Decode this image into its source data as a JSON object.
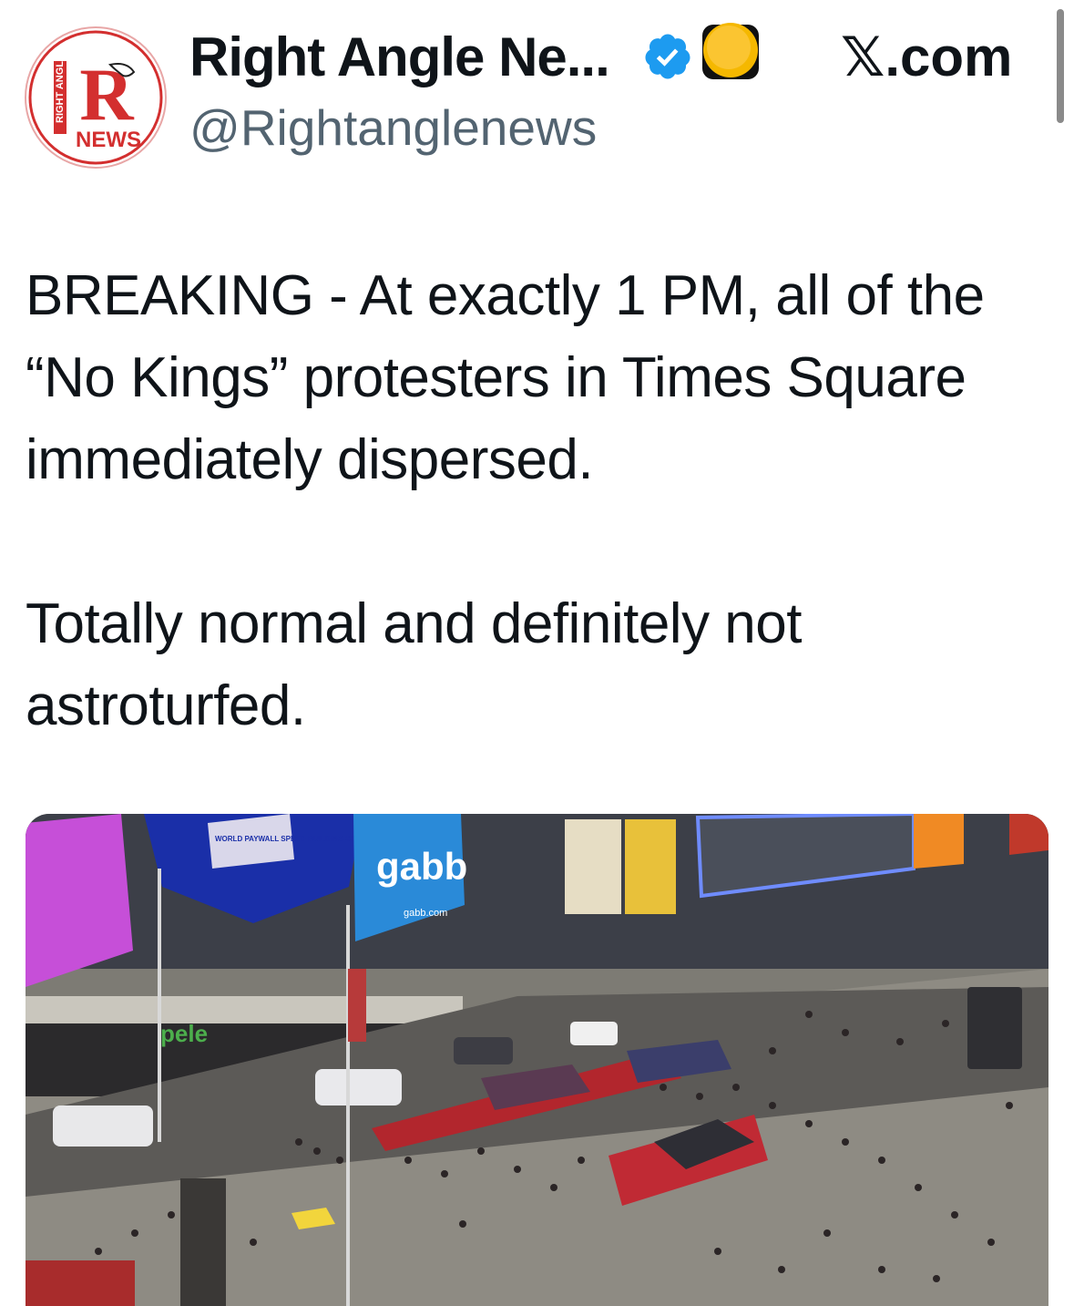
{
  "header": {
    "display_name": "Right Angle Ne...",
    "handle": "@Rightanglenews",
    "platform": "𝕏.com",
    "avatar": {
      "logo_top_text": "RIGHT ANGLE",
      "logo_letter": "R",
      "logo_bottom_text": "NEWS"
    },
    "verified_icon": "verified-badge-icon",
    "affiliate_icon": "affiliate-badge-icon"
  },
  "tweet": {
    "paragraphs": [
      "BREAKING - At exactly 1 PM, all of the “No Kings” protesters in Times Square immediately dispersed.",
      "Totally normal and definitely not astroturfed."
    ]
  },
  "media": {
    "sign_world_text": "WORLD PAYWALL SPEED-BUILDING CHAMPIONSHIPS",
    "sign_gabb": "gabb",
    "sign_gabb_url": "gabb.com",
    "sign_pele": "pele"
  },
  "colors": {
    "text": "#0f1419",
    "secondary_text": "#536471",
    "verified_blue": "#1d9bf0",
    "affiliate_gold": "#f4b400",
    "logo_red": "#d32f2f"
  }
}
